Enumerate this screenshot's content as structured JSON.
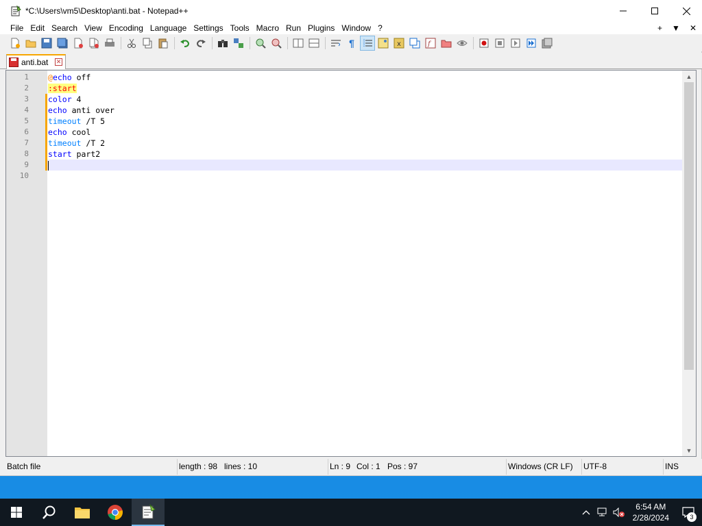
{
  "window": {
    "title": "*C:\\Users\\vm5\\Desktop\\anti.bat - Notepad++",
    "icons": {
      "app": "notepadpp-icon",
      "minimize": "minimize-icon",
      "maximize": "maximize-icon",
      "close": "close-icon"
    }
  },
  "menu": {
    "items": [
      "File",
      "Edit",
      "Search",
      "View",
      "Encoding",
      "Language",
      "Settings",
      "Tools",
      "Macro",
      "Run",
      "Plugins",
      "Window",
      "?"
    ],
    "right": {
      "plus": "+",
      "down": "▼",
      "close": "✕"
    }
  },
  "toolbar": {
    "buttons": [
      "new-file",
      "open-file",
      "save",
      "save-all",
      "close",
      "close-all",
      "print",
      "cut",
      "copy",
      "paste",
      "undo",
      "redo",
      "find",
      "replace",
      "zoom-in",
      "zoom-out",
      "sync-vertical",
      "sync-horizontal",
      "word-wrap",
      "show-all-chars",
      "indent-guide",
      "udl",
      "doc-map",
      "doc-list",
      "function-list",
      "folder-workspace",
      "monitoring",
      "macro-record",
      "macro-stop",
      "macro-play",
      "macro-run-multiple",
      "macro-save"
    ],
    "active": "indent-guide"
  },
  "tabs": [
    {
      "label": "anti.bat",
      "icon": "floppy-modified-icon",
      "close": "✕"
    }
  ],
  "editor": {
    "line_numbers": [
      "1",
      "2",
      "3",
      "4",
      "5",
      "6",
      "7",
      "8",
      "9",
      "10"
    ],
    "lines": [
      [
        {
          "t": "@",
          "c": "at"
        },
        {
          "t": "echo",
          "c": "kw"
        },
        {
          "t": " off",
          "c": "txt"
        }
      ],
      [
        {
          "t": ":start",
          "c": "label"
        }
      ],
      [
        {
          "t": "color",
          "c": "kw"
        },
        {
          "t": " 4",
          "c": "txt"
        }
      ],
      [
        {
          "t": "echo",
          "c": "kw"
        },
        {
          "t": " anti over",
          "c": "txt"
        }
      ],
      [
        {
          "t": "timeout",
          "c": "ext"
        },
        {
          "t": " /T 5",
          "c": "txt"
        }
      ],
      [
        {
          "t": "echo",
          "c": "kw"
        },
        {
          "t": " cool",
          "c": "txt"
        }
      ],
      [
        {
          "t": "timeout",
          "c": "ext"
        },
        {
          "t": " /T 2",
          "c": "txt"
        }
      ],
      [
        {
          "t": "start",
          "c": "kw"
        },
        {
          "t": " part2",
          "c": "txt"
        }
      ],
      [],
      []
    ],
    "current_line": 9,
    "colors": {
      "keyword": "#0000ff",
      "external": "#0080ff",
      "at": "#ff8000",
      "label_fg": "#ff0000",
      "label_bg": "#ffff80",
      "current_line_bg": "#e8e8ff",
      "change_marker": "#f7a600"
    }
  },
  "status": {
    "language": "Batch file",
    "length": "length : 98",
    "lines": "lines : 10",
    "ln": "Ln : 9",
    "col": "Col : 1",
    "pos": "Pos : 97",
    "eol": "Windows (CR LF)",
    "encoding": "UTF-8",
    "mode": "INS"
  },
  "taskbar": {
    "apps": [
      "start-icon",
      "search-icon",
      "file-explorer-icon",
      "chrome-icon",
      "notepadpp-icon"
    ],
    "active_app": "notepadpp-icon",
    "tray": [
      "chevron-up-icon",
      "network-icon",
      "volume-muted-icon"
    ],
    "time": "6:54 AM",
    "date": "2/28/2024",
    "notification_count": "3"
  }
}
